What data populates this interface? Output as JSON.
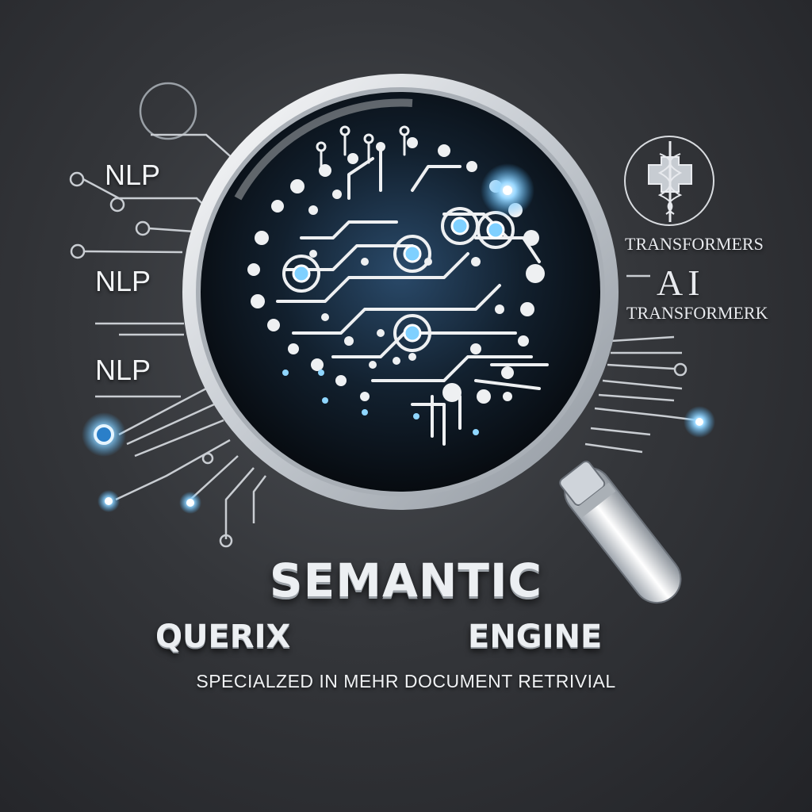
{
  "labels": {
    "nlp_1": "NLP",
    "nlp_2": "NLP",
    "nlp_3": "NLP",
    "transformers": "TRANSFORMERS",
    "ai": "AI",
    "transformerk": "TRANSFORMERK"
  },
  "title": {
    "line1": "SEMANTIC",
    "line2_left": "QUERIX",
    "line2_right": "ENGINE"
  },
  "subtitle": "SPECIALZED IN MEHR DOCUMENT RETRIVIAL",
  "icons": [
    "magnifying-glass-icon",
    "brain-circuit-icon",
    "caduceus-icon"
  ],
  "colors": {
    "background": "#2e3034",
    "glow": "#4fb8ff",
    "circuit": "#e6e8ec",
    "lens": "#101a26"
  }
}
